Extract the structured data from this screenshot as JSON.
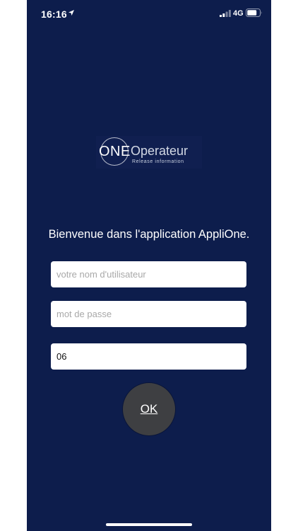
{
  "status_bar": {
    "time": "16:16",
    "network": "4G",
    "location_icon": "location-arrow-icon",
    "signal_icon": "cellular-signal-icon",
    "battery_icon": "battery-icon"
  },
  "logo": {
    "brand": "ONE",
    "product": "Operateur",
    "tagline": "Release information"
  },
  "welcome": "Bienvenue dans l'application AppliOne.",
  "form": {
    "username_placeholder": "votre nom d'utilisateur",
    "password_placeholder": "mot de passe",
    "code_value": "06",
    "ok_label": "OK"
  },
  "colors": {
    "background": "#0d1d4c",
    "button": "#3e3f42",
    "field": "#ffffff"
  }
}
